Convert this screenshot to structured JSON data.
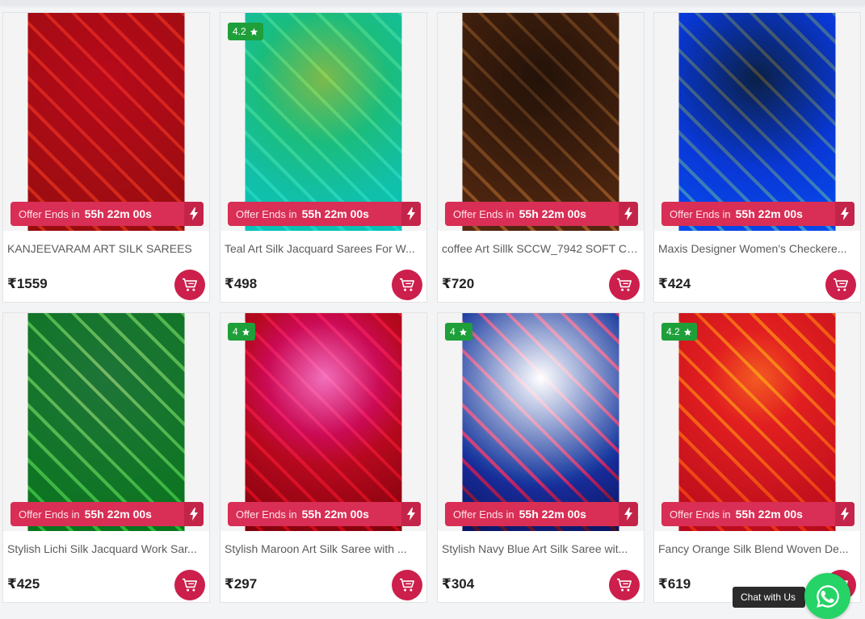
{
  "products": [
    {
      "name": "KANJEEVARAM ART SILK SAREES",
      "price": "₹1559",
      "rating": "",
      "offer_label": "Offer Ends in",
      "offer_time": "55h 22m 00s",
      "colors": {
        "a": "#8a2a2a",
        "b": "#c98a3b",
        "c": "#b01d4f"
      }
    },
    {
      "name": "Teal Art Silk Jacquard Sarees For W...",
      "price": "₹498",
      "rating": "4.2",
      "offer_label": "Offer Ends in",
      "offer_time": "55h 22m 00s",
      "colors": {
        "a": "#1ba7a6",
        "b": "#3cc3b9",
        "c": "#b69a3a"
      }
    },
    {
      "name": "coffee Art Sillk SCCW_7942 SOFT Cr...",
      "price": "₹720",
      "rating": "",
      "offer_label": "Offer Ends in",
      "offer_time": "55h 22m 00s",
      "colors": {
        "a": "#6b4a2f",
        "b": "#c9a36a",
        "c": "#2a1f17"
      }
    },
    {
      "name": "Maxis Designer Women's Checkere...",
      "price": "₹424",
      "rating": "",
      "offer_label": "Offer Ends in",
      "offer_time": "55h 22m 00s",
      "colors": {
        "a": "#1f64d6",
        "b": "#d8c8a8",
        "c": "#2a2a2a"
      }
    },
    {
      "name": "Stylish Lichi Silk Jacquard Work Sar...",
      "price": "₹425",
      "rating": "",
      "offer_label": "Offer Ends in",
      "offer_time": "55h 22m 00s",
      "colors": {
        "a": "#1f7a3a",
        "b": "#7fbf6a",
        "c": "#7a7a7a"
      }
    },
    {
      "name": "Stylish Maroon Art Silk Saree with ...",
      "price": "₹297",
      "rating": "4",
      "offer_label": "Offer Ends in",
      "offer_time": "55h 22m 00s",
      "colors": {
        "a": "#7a0b1e",
        "b": "#c51b2e",
        "c": "#f2b3d8"
      }
    },
    {
      "name": "Stylish Navy Blue Art Silk Saree wit...",
      "price": "₹304",
      "rating": "4",
      "offer_label": "Offer Ends in",
      "offer_time": "55h 22m 00s",
      "colors": {
        "a": "#1a2b6b",
        "b": "#c9201f",
        "c": "#ffffff"
      }
    },
    {
      "name": "Fancy Orange Silk Blend Woven De...",
      "price": "₹619",
      "rating": "4.2",
      "offer_label": "Offer Ends in",
      "offer_time": "55h 22m 00s",
      "colors": {
        "a": "#9a1f3a",
        "b": "#e0712a",
        "c": "#f0a14a"
      }
    }
  ],
  "chat": {
    "label": "Chat with Us"
  },
  "accent": "#cc1f4c",
  "offer_color": "#d92e55",
  "rating_color": "#1f9f3a"
}
